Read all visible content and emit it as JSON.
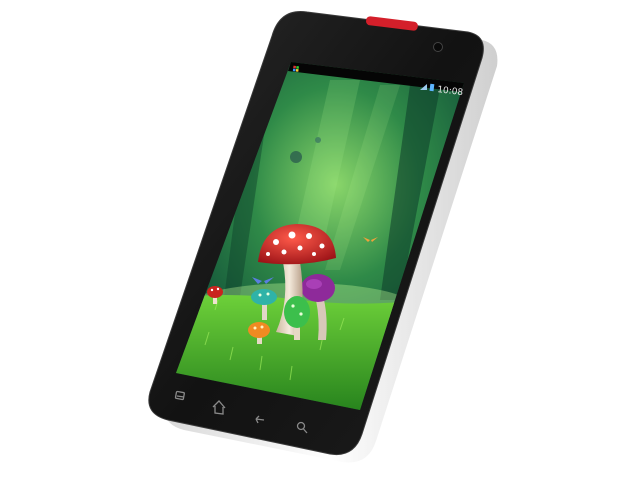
{
  "status_bar": {
    "time": "10:08",
    "icons": [
      "app-grid-icon",
      "signal-icon",
      "battery-icon"
    ]
  },
  "nav_bar": {
    "icons": [
      "menu-icon",
      "home-icon",
      "back-icon",
      "search-icon"
    ]
  },
  "colors": {
    "phone_body": "#141414",
    "phone_side": "#f2f2f2",
    "speaker_grille": "#d41f2a",
    "mushroom_cap": "#d8262a",
    "grass": "#3fae2a",
    "forest": "#1f6b3b"
  }
}
